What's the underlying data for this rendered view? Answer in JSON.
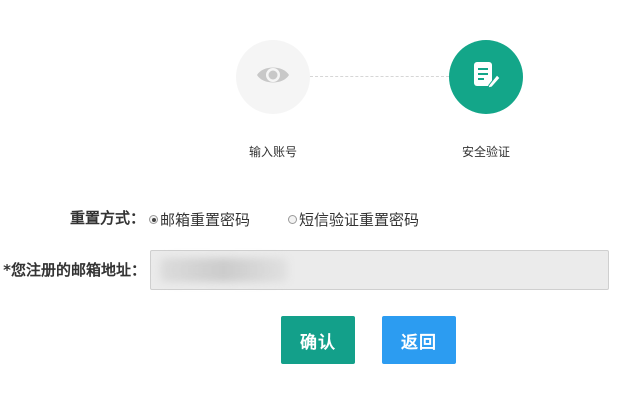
{
  "steps": [
    {
      "label": "输入账号",
      "icon": "eye-icon",
      "active": false
    },
    {
      "label": "安全验证",
      "icon": "document-edit-icon",
      "active": true
    }
  ],
  "form": {
    "method_label": "重置方式：",
    "methods": [
      {
        "label": "邮箱重置密码",
        "checked": true
      },
      {
        "label": "短信验证重置密码",
        "checked": false
      }
    ],
    "email_label": "*您注册的邮箱地址：",
    "email_value": ""
  },
  "buttons": {
    "confirm": "确认",
    "back": "返回"
  },
  "colors": {
    "primary_green": "#13a689",
    "confirm_green": "#13a08a",
    "back_blue": "#2c9cf1",
    "inactive_circle": "#f5f5f5"
  }
}
